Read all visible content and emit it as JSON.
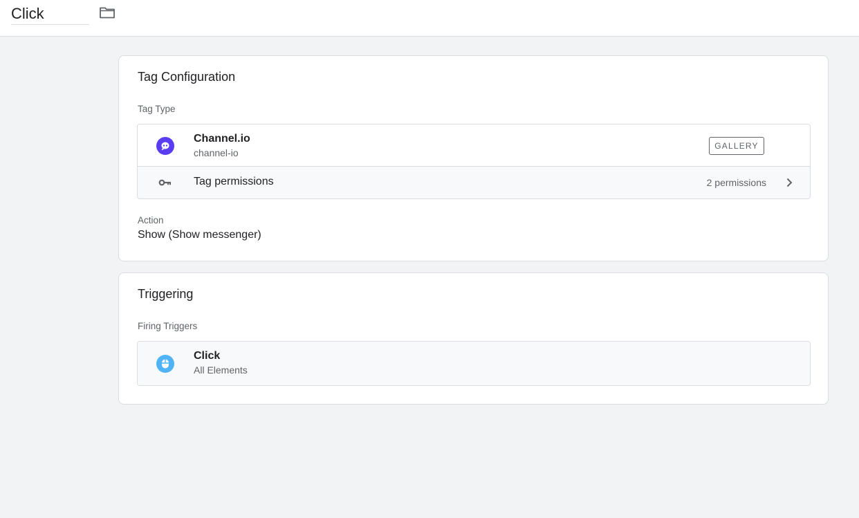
{
  "header": {
    "tag_name": "Click",
    "folder_icon": "folder-icon"
  },
  "tag_configuration": {
    "title": "Tag Configuration",
    "tag_type_label": "Tag Type",
    "tag_type": {
      "name": "Channel.io",
      "id": "channel-io",
      "icon": "channel-io-logo-icon",
      "icon_color": "#5a3cf2",
      "gallery_label": "GALLERY"
    },
    "permissions": {
      "label": "Tag permissions",
      "count_text": "2 permissions",
      "icon": "key-icon"
    },
    "action_label": "Action",
    "action_value": "Show (Show messenger)"
  },
  "triggering": {
    "title": "Triggering",
    "firing_triggers_label": "Firing Triggers",
    "triggers": [
      {
        "name": "Click",
        "subtitle": "All Elements",
        "icon": "mouse-icon",
        "icon_color": "#4fb3f6"
      }
    ]
  }
}
